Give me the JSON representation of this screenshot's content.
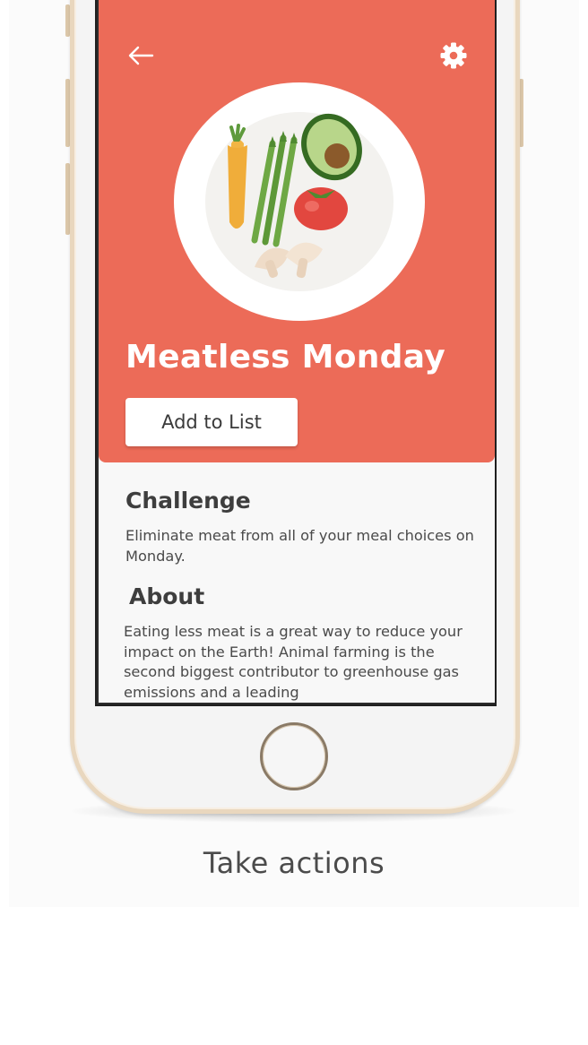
{
  "screen": {
    "title": "Meatless Monday",
    "add_button_label": "Add to List",
    "sections": [
      {
        "heading": "Challenge",
        "body": "Eliminate meat from all of your meal choices on Monday."
      },
      {
        "heading": "About",
        "body": "Eating less meat is a great way to reduce your impact on the Earth! Animal farming is the second biggest contributor to greenhouse gas emissions and a leading"
      }
    ],
    "icons": {
      "back": "arrow-left-icon",
      "settings": "gear-icon",
      "hero": "vegetable-plate-illustration"
    }
  },
  "caption": "Take actions",
  "colors": {
    "hero_background": "#ec6b58",
    "content_background": "#f8f8f8",
    "phone_frame": "#e9d7be"
  }
}
